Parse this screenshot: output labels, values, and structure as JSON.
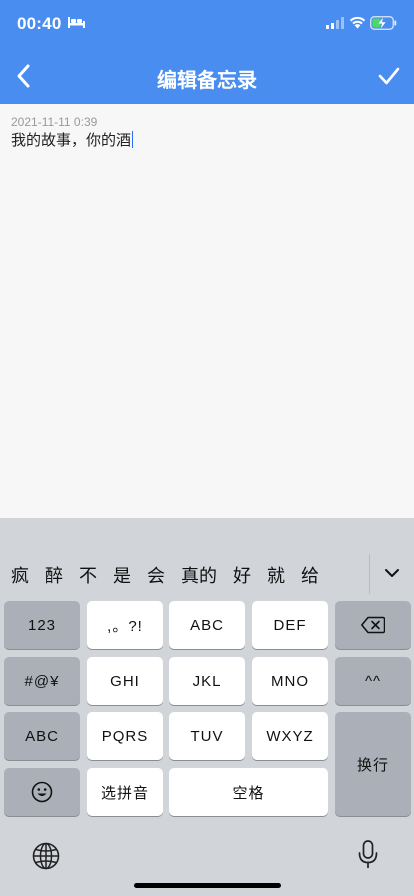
{
  "status": {
    "time": "00:40"
  },
  "header": {
    "title": "编辑备忘录"
  },
  "note": {
    "date": "2021-11-11 0:39",
    "text": "我的故事，你的酒"
  },
  "keyboard": {
    "candidates": [
      "疯",
      "醉",
      "不",
      "是",
      "会",
      "真的",
      "好",
      "就",
      "给"
    ],
    "keys": {
      "num": "123",
      "punct": ",。?!",
      "abc1": "ABC",
      "def": "DEF",
      "sym": "#@¥",
      "ghi": "GHI",
      "jkl": "JKL",
      "mno": "MNO",
      "face": "^^",
      "abc_mode": "ABC",
      "pqrs": "PQRS",
      "tuv": "TUV",
      "wxyz": "WXYZ",
      "enter": "换行",
      "pinyin": "选拼音",
      "space": "空格"
    }
  },
  "colors": {
    "header": "#4a8df0",
    "keyboard": "#d1d4d9",
    "caret": "#2d6cf5"
  }
}
